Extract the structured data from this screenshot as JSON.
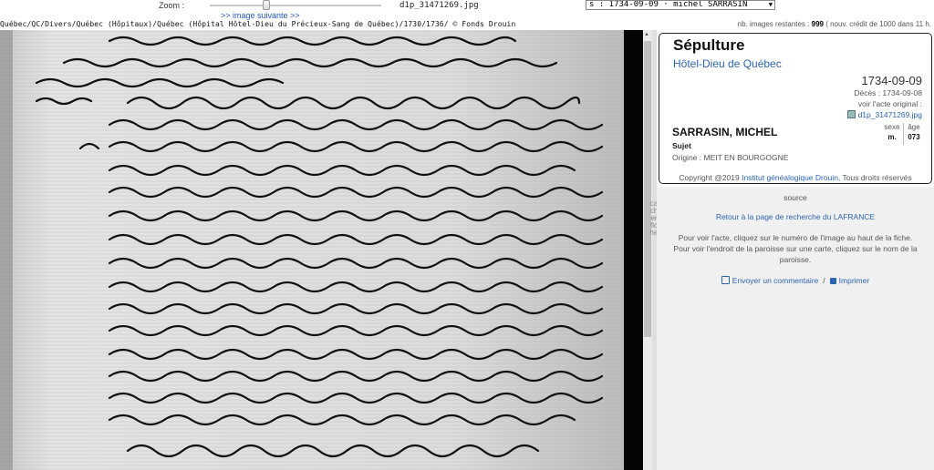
{
  "toolbar": {
    "zoom_label": "Zoom :",
    "next_image": ">> image suivante >>",
    "filename": "d1p_31471269.jpg",
    "record_select_value": "s : 1734-09-09 · michel SARRASIN",
    "path": "Québec/QC/Divers/Québec (Hôpitaux)/Québec (Hôpital Hôtel-Dieu du Précieux-Sang de Québec)/1730/1736/ © Fonds Drouin",
    "images_remaining_label": "nb. images restantes :",
    "images_remaining_count": "999",
    "images_remaining_note": "( nouv. crédit de 1000 dans 11 h."
  },
  "viewer": {
    "side_label": "cacher fiche"
  },
  "card": {
    "title": "Sépulture",
    "place": "Hôtel-Dieu de Québec",
    "date": "1734-09-09",
    "deces": "Décès : 1734-09-08",
    "voir_acte": "voir l'acte original :",
    "file_link": "d1p_31471269.jpg",
    "name": "SARRASIN, MICHEL",
    "role": "Sujet",
    "origin": "Origine : MEIT EN BOURGOGNE",
    "sex_label": "sexe",
    "sex_value": "m.",
    "age_label": "âge",
    "age_value": "073",
    "copyright_prefix": "Copyright @2019",
    "copyright_link": "Institut généalogique Drouin,",
    "copyright_suffix": "Tous droits réservés"
  },
  "panel": {
    "source": "source",
    "return_link": "Retour à la page de recherche du LAFRANCE",
    "instruction_1": "Pour voir l'acte, cliquez sur le numéro de l'image au haut de la fiche.",
    "instruction_2": "Pour voir l'endroit de la paroisse sur une carte, cliquez sur le nom de la paroisse.",
    "comment_link": "Envoyer un commentaire",
    "separator": "/",
    "print_link": "Imprimer"
  }
}
